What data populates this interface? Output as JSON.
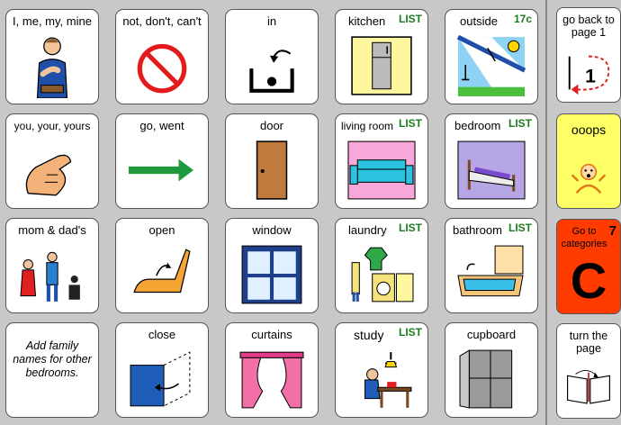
{
  "cells": {
    "me": {
      "label": "I, me, my, mine"
    },
    "not": {
      "label": "not, don't, can't"
    },
    "in": {
      "label": "in"
    },
    "kitchen": {
      "label": "kitchen",
      "badge": "LIST"
    },
    "outside": {
      "label": "outside",
      "badge": "17c"
    },
    "you": {
      "label": "you, your, yours"
    },
    "go": {
      "label": "go, went"
    },
    "door": {
      "label": "door"
    },
    "living": {
      "label": "living room",
      "badge": "LIST"
    },
    "bedroom": {
      "label": "bedroom",
      "badge": "LIST"
    },
    "mom": {
      "label": "mom & dad's"
    },
    "open": {
      "label": "open"
    },
    "window": {
      "label": "window"
    },
    "laundry": {
      "label": "laundry",
      "badge": "LIST"
    },
    "bathroom": {
      "label": "bathroom",
      "badge": "LIST"
    },
    "note": {
      "label": "Add family names for other bedrooms."
    },
    "close": {
      "label": "close"
    },
    "curtains": {
      "label": "curtains"
    },
    "study": {
      "label": "study",
      "badge": "LIST"
    },
    "cupboard": {
      "label": "cupboard"
    }
  },
  "sidebar": {
    "back": {
      "label": "go back to page 1",
      "number": "1"
    },
    "ooops": {
      "label": "ooops"
    },
    "categories": {
      "label": "Go to categories",
      "badge": "7",
      "letter": "C"
    },
    "turn": {
      "label": "turn the page"
    }
  },
  "colors": {
    "list_badge": "#1e7a1e",
    "ooops_bg": "#ffff66",
    "categories_bg": "#ff3b00"
  }
}
